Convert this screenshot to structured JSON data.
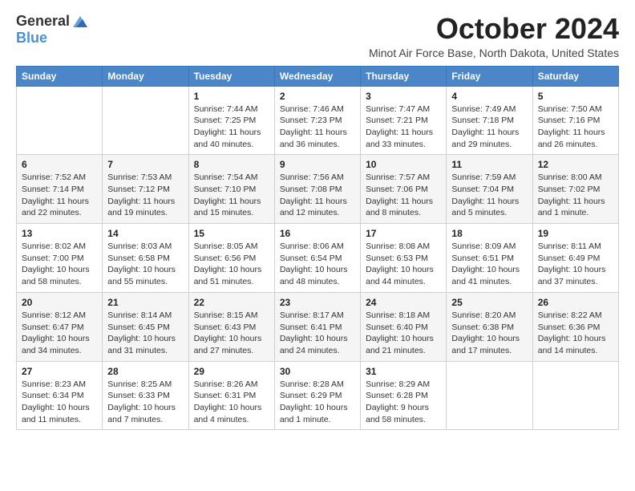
{
  "header": {
    "logo_general": "General",
    "logo_blue": "Blue",
    "month_title": "October 2024",
    "subtitle": "Minot Air Force Base, North Dakota, United States"
  },
  "days_of_week": [
    "Sunday",
    "Monday",
    "Tuesday",
    "Wednesday",
    "Thursday",
    "Friday",
    "Saturday"
  ],
  "weeks": [
    [
      {
        "day": "",
        "sunrise": "",
        "sunset": "",
        "daylight": ""
      },
      {
        "day": "",
        "sunrise": "",
        "sunset": "",
        "daylight": ""
      },
      {
        "day": "1",
        "sunrise": "Sunrise: 7:44 AM",
        "sunset": "Sunset: 7:25 PM",
        "daylight": "Daylight: 11 hours and 40 minutes."
      },
      {
        "day": "2",
        "sunrise": "Sunrise: 7:46 AM",
        "sunset": "Sunset: 7:23 PM",
        "daylight": "Daylight: 11 hours and 36 minutes."
      },
      {
        "day": "3",
        "sunrise": "Sunrise: 7:47 AM",
        "sunset": "Sunset: 7:21 PM",
        "daylight": "Daylight: 11 hours and 33 minutes."
      },
      {
        "day": "4",
        "sunrise": "Sunrise: 7:49 AM",
        "sunset": "Sunset: 7:18 PM",
        "daylight": "Daylight: 11 hours and 29 minutes."
      },
      {
        "day": "5",
        "sunrise": "Sunrise: 7:50 AM",
        "sunset": "Sunset: 7:16 PM",
        "daylight": "Daylight: 11 hours and 26 minutes."
      }
    ],
    [
      {
        "day": "6",
        "sunrise": "Sunrise: 7:52 AM",
        "sunset": "Sunset: 7:14 PM",
        "daylight": "Daylight: 11 hours and 22 minutes."
      },
      {
        "day": "7",
        "sunrise": "Sunrise: 7:53 AM",
        "sunset": "Sunset: 7:12 PM",
        "daylight": "Daylight: 11 hours and 19 minutes."
      },
      {
        "day": "8",
        "sunrise": "Sunrise: 7:54 AM",
        "sunset": "Sunset: 7:10 PM",
        "daylight": "Daylight: 11 hours and 15 minutes."
      },
      {
        "day": "9",
        "sunrise": "Sunrise: 7:56 AM",
        "sunset": "Sunset: 7:08 PM",
        "daylight": "Daylight: 11 hours and 12 minutes."
      },
      {
        "day": "10",
        "sunrise": "Sunrise: 7:57 AM",
        "sunset": "Sunset: 7:06 PM",
        "daylight": "Daylight: 11 hours and 8 minutes."
      },
      {
        "day": "11",
        "sunrise": "Sunrise: 7:59 AM",
        "sunset": "Sunset: 7:04 PM",
        "daylight": "Daylight: 11 hours and 5 minutes."
      },
      {
        "day": "12",
        "sunrise": "Sunrise: 8:00 AM",
        "sunset": "Sunset: 7:02 PM",
        "daylight": "Daylight: 11 hours and 1 minute."
      }
    ],
    [
      {
        "day": "13",
        "sunrise": "Sunrise: 8:02 AM",
        "sunset": "Sunset: 7:00 PM",
        "daylight": "Daylight: 10 hours and 58 minutes."
      },
      {
        "day": "14",
        "sunrise": "Sunrise: 8:03 AM",
        "sunset": "Sunset: 6:58 PM",
        "daylight": "Daylight: 10 hours and 55 minutes."
      },
      {
        "day": "15",
        "sunrise": "Sunrise: 8:05 AM",
        "sunset": "Sunset: 6:56 PM",
        "daylight": "Daylight: 10 hours and 51 minutes."
      },
      {
        "day": "16",
        "sunrise": "Sunrise: 8:06 AM",
        "sunset": "Sunset: 6:54 PM",
        "daylight": "Daylight: 10 hours and 48 minutes."
      },
      {
        "day": "17",
        "sunrise": "Sunrise: 8:08 AM",
        "sunset": "Sunset: 6:53 PM",
        "daylight": "Daylight: 10 hours and 44 minutes."
      },
      {
        "day": "18",
        "sunrise": "Sunrise: 8:09 AM",
        "sunset": "Sunset: 6:51 PM",
        "daylight": "Daylight: 10 hours and 41 minutes."
      },
      {
        "day": "19",
        "sunrise": "Sunrise: 8:11 AM",
        "sunset": "Sunset: 6:49 PM",
        "daylight": "Daylight: 10 hours and 37 minutes."
      }
    ],
    [
      {
        "day": "20",
        "sunrise": "Sunrise: 8:12 AM",
        "sunset": "Sunset: 6:47 PM",
        "daylight": "Daylight: 10 hours and 34 minutes."
      },
      {
        "day": "21",
        "sunrise": "Sunrise: 8:14 AM",
        "sunset": "Sunset: 6:45 PM",
        "daylight": "Daylight: 10 hours and 31 minutes."
      },
      {
        "day": "22",
        "sunrise": "Sunrise: 8:15 AM",
        "sunset": "Sunset: 6:43 PM",
        "daylight": "Daylight: 10 hours and 27 minutes."
      },
      {
        "day": "23",
        "sunrise": "Sunrise: 8:17 AM",
        "sunset": "Sunset: 6:41 PM",
        "daylight": "Daylight: 10 hours and 24 minutes."
      },
      {
        "day": "24",
        "sunrise": "Sunrise: 8:18 AM",
        "sunset": "Sunset: 6:40 PM",
        "daylight": "Daylight: 10 hours and 21 minutes."
      },
      {
        "day": "25",
        "sunrise": "Sunrise: 8:20 AM",
        "sunset": "Sunset: 6:38 PM",
        "daylight": "Daylight: 10 hours and 17 minutes."
      },
      {
        "day": "26",
        "sunrise": "Sunrise: 8:22 AM",
        "sunset": "Sunset: 6:36 PM",
        "daylight": "Daylight: 10 hours and 14 minutes."
      }
    ],
    [
      {
        "day": "27",
        "sunrise": "Sunrise: 8:23 AM",
        "sunset": "Sunset: 6:34 PM",
        "daylight": "Daylight: 10 hours and 11 minutes."
      },
      {
        "day": "28",
        "sunrise": "Sunrise: 8:25 AM",
        "sunset": "Sunset: 6:33 PM",
        "daylight": "Daylight: 10 hours and 7 minutes."
      },
      {
        "day": "29",
        "sunrise": "Sunrise: 8:26 AM",
        "sunset": "Sunset: 6:31 PM",
        "daylight": "Daylight: 10 hours and 4 minutes."
      },
      {
        "day": "30",
        "sunrise": "Sunrise: 8:28 AM",
        "sunset": "Sunset: 6:29 PM",
        "daylight": "Daylight: 10 hours and 1 minute."
      },
      {
        "day": "31",
        "sunrise": "Sunrise: 8:29 AM",
        "sunset": "Sunset: 6:28 PM",
        "daylight": "Daylight: 9 hours and 58 minutes."
      },
      {
        "day": "",
        "sunrise": "",
        "sunset": "",
        "daylight": ""
      },
      {
        "day": "",
        "sunrise": "",
        "sunset": "",
        "daylight": ""
      }
    ]
  ]
}
